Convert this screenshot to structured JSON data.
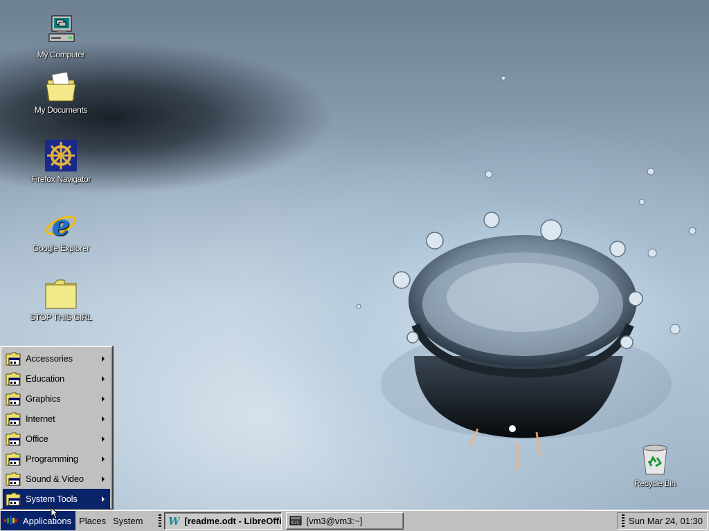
{
  "desktop_icons": [
    {
      "id": "my-computer",
      "label": "My Computer",
      "icon": "computer-icon"
    },
    {
      "id": "my-documents",
      "label": "My Documents",
      "icon": "folder-documents-icon"
    },
    {
      "id": "firefox-navigator",
      "label": "Firefox Navigator",
      "icon": "ship-wheel-icon"
    },
    {
      "id": "google-explorer",
      "label": "Google Explorer",
      "icon": "internet-explorer-icon"
    },
    {
      "id": "stop-this-girl",
      "label": "STOP THIS GIRL",
      "icon": "folder-icon"
    },
    {
      "id": "recycle-bin",
      "label": "Recycle Bin",
      "icon": "recycle-bin-icon"
    }
  ],
  "app_menu": {
    "items": [
      {
        "label": "Accessories",
        "active": false
      },
      {
        "label": "Education",
        "active": false
      },
      {
        "label": "Graphics",
        "active": false
      },
      {
        "label": "Internet",
        "active": false
      },
      {
        "label": "Office",
        "active": false
      },
      {
        "label": "Programming",
        "active": false
      },
      {
        "label": "Sound & Video",
        "active": false
      },
      {
        "label": "System Tools",
        "active": true
      }
    ]
  },
  "taskbar": {
    "applications_label": "Applications",
    "places_label": "Places",
    "system_label": "System",
    "tasks": [
      {
        "label": "[readme.odt - LibreOffi...",
        "icon": "libreoffice-writer-icon",
        "pressed": true
      },
      {
        "label": "[vm3@vm3:~]",
        "icon": "terminal-icon",
        "pressed": false
      }
    ],
    "clock": "Sun Mar 24, 01:30"
  },
  "colors": {
    "menu_highlight": "#0a246a",
    "menu_background": "#c0c0c0",
    "taskbar_background": "#c0c0c0"
  }
}
